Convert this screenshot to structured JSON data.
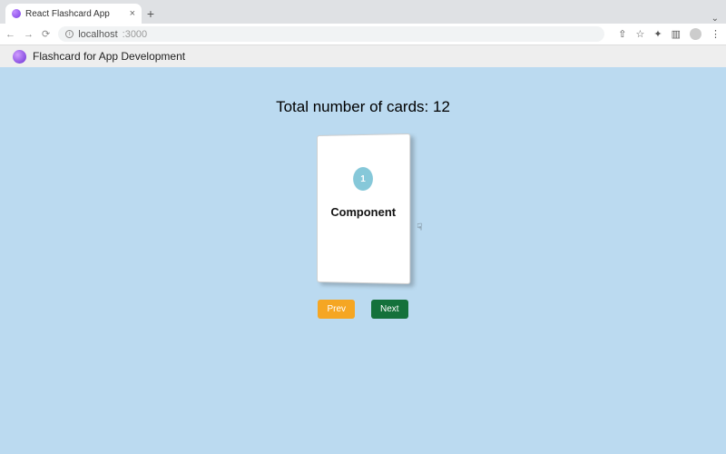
{
  "browser": {
    "tab_title": "React Flashcard App",
    "url_host": "localhost",
    "url_port": ":3000"
  },
  "app": {
    "title": "Flashcard for App Development"
  },
  "counter": {
    "label_prefix": "Total number of cards: ",
    "value": "12"
  },
  "card": {
    "index": "1",
    "term": "Component"
  },
  "buttons": {
    "prev": "Prev",
    "next": "Next"
  }
}
